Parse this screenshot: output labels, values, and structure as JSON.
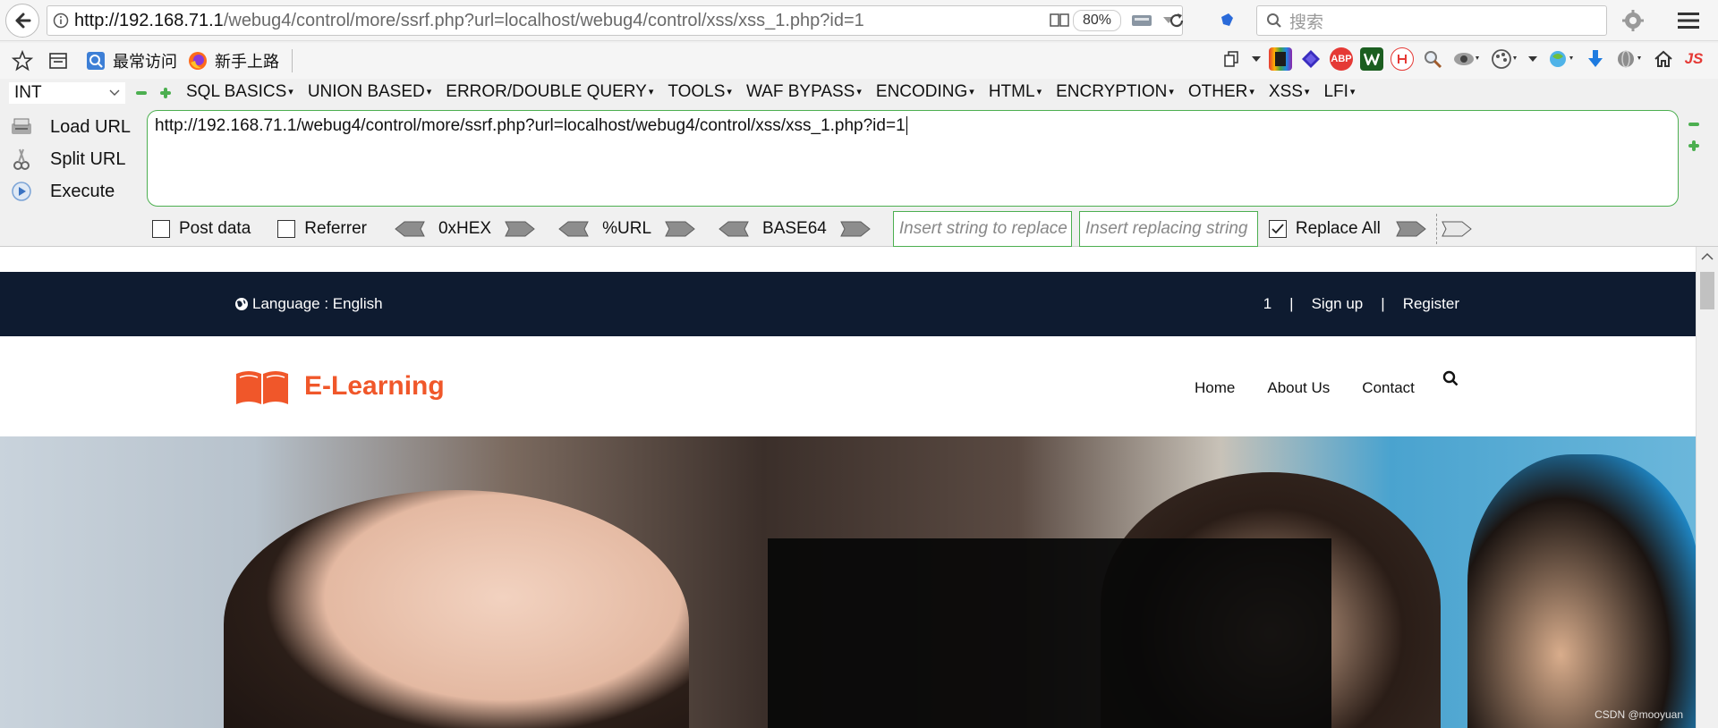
{
  "browser": {
    "url_host": "http://192.168.71.1",
    "url_path": "/webug4/control/more/ssrf.php?url=localhost/webug4/control/xss/xss_1.php?id=1",
    "zoom": "80%",
    "search_placeholder": "搜索"
  },
  "bookmarks": [
    {
      "label": "最常访问",
      "icon": "compass-icon"
    },
    {
      "label": "新手上路",
      "icon": "firefox-icon"
    }
  ],
  "hackbar": {
    "type_value": "INT",
    "menus": [
      "SQL BASICS",
      "UNION BASED",
      "ERROR/DOUBLE QUERY",
      "TOOLS",
      "WAF BYPASS",
      "ENCODING",
      "HTML",
      "ENCRYPTION",
      "OTHER",
      "XSS",
      "LFI"
    ],
    "actions": {
      "load": "Load URL",
      "split": "Split URL",
      "execute": "Execute"
    },
    "textarea_value": "http://192.168.71.1/webug4/control/more/ssrf.php?url=localhost/webug4/control/xss/xss_1.php?id=1",
    "post_data": "Post data",
    "referrer": "Referrer",
    "enc": [
      "0xHEX",
      "%URL",
      "BASE64"
    ],
    "replace_placeholder": "Insert string to replace",
    "replacing_placeholder": "Insert replacing string",
    "replace_all": "Replace All",
    "replace_all_checked": true
  },
  "site": {
    "language": "Language : English",
    "top_links": [
      "1",
      "|",
      "Sign up",
      "|",
      "Register"
    ],
    "brand": "E-Learning",
    "brand_color": "#f0572a",
    "nav": [
      "Home",
      "About Us",
      "Contact"
    ],
    "topbar_color": "#0e1b30"
  },
  "watermark": "CSDN @mooyuan"
}
